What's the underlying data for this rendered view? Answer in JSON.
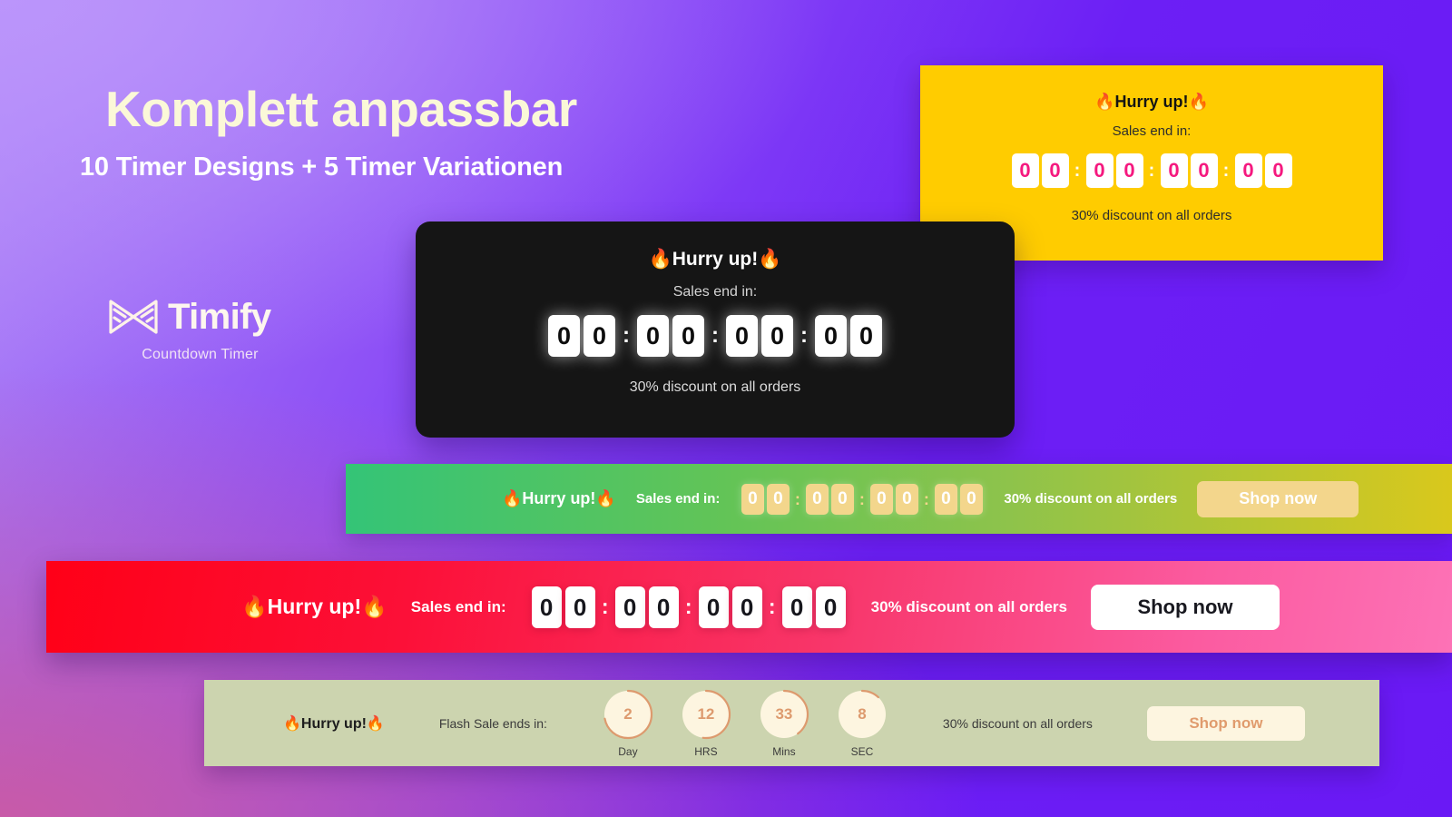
{
  "headline": {
    "title": "Komplett anpassbar",
    "subtitle": "10 Timer Designs + 5 Timer Variationen"
  },
  "brand": {
    "name": "Timify",
    "tagline": "Countdown Timer",
    "logo_icon": "hourglass-bowtie-icon"
  },
  "colors": {
    "background_start": "#b088f7",
    "background_end": "#6a19f5",
    "yellow_card": "#ffcc00",
    "yellow_digit": "#f5187f",
    "dark_card": "#151515",
    "green_bar_start": "#34c477",
    "green_bar_end": "#d9c81c",
    "green_tile": "#f3d68c",
    "red_bar_start": "#ff0017",
    "red_bar_end": "#fd72b6",
    "sage_bar": "#ccd4af",
    "sage_accent": "#dd9a6e",
    "sage_tile": "#fdf5e0"
  },
  "timers": {
    "yellow": {
      "hurry": "Hurry up!",
      "flame": "🔥",
      "sales_label": "Sales end in:",
      "groups": [
        [
          "0",
          "0"
        ],
        [
          "0",
          "0"
        ],
        [
          "0",
          "0"
        ],
        [
          "0",
          "0"
        ]
      ],
      "separator": ":",
      "discount": "30% discount on all orders"
    },
    "dark": {
      "hurry": "Hurry up!",
      "flame": "🔥",
      "sales_label": "Sales end in:",
      "groups": [
        [
          "0",
          "0"
        ],
        [
          "0",
          "0"
        ],
        [
          "0",
          "0"
        ],
        [
          "0",
          "0"
        ]
      ],
      "separator": ":",
      "discount": "30% discount on all orders"
    },
    "green": {
      "hurry": "Hurry up!",
      "flame": "🔥",
      "sales_label": "Sales end in:",
      "groups": [
        [
          "0",
          "0"
        ],
        [
          "0",
          "0"
        ],
        [
          "0",
          "0"
        ],
        [
          "0",
          "0"
        ]
      ],
      "separator": ":",
      "discount": "30% discount on all orders",
      "cta": "Shop now"
    },
    "red": {
      "hurry": "Hurry up!",
      "flame": "🔥",
      "sales_label": "Sales end in:",
      "groups": [
        [
          "0",
          "0"
        ],
        [
          "0",
          "0"
        ],
        [
          "0",
          "0"
        ],
        [
          "0",
          "0"
        ]
      ],
      "separator": ":",
      "discount": "30% discount on all orders",
      "cta": "Shop now"
    },
    "sage": {
      "hurry": "Hurry up!",
      "flame": "🔥",
      "sales_label": "Flash Sale ends in:",
      "units": [
        {
          "value": "2",
          "label": "Day",
          "progress": 0.72
        },
        {
          "value": "12",
          "label": "HRS",
          "progress": 0.52
        },
        {
          "value": "33",
          "label": "Mins",
          "progress": 0.4
        },
        {
          "value": "8",
          "label": "SEC",
          "progress": 0.12
        }
      ],
      "discount": "30% discount on all orders",
      "cta": "Shop now"
    }
  }
}
